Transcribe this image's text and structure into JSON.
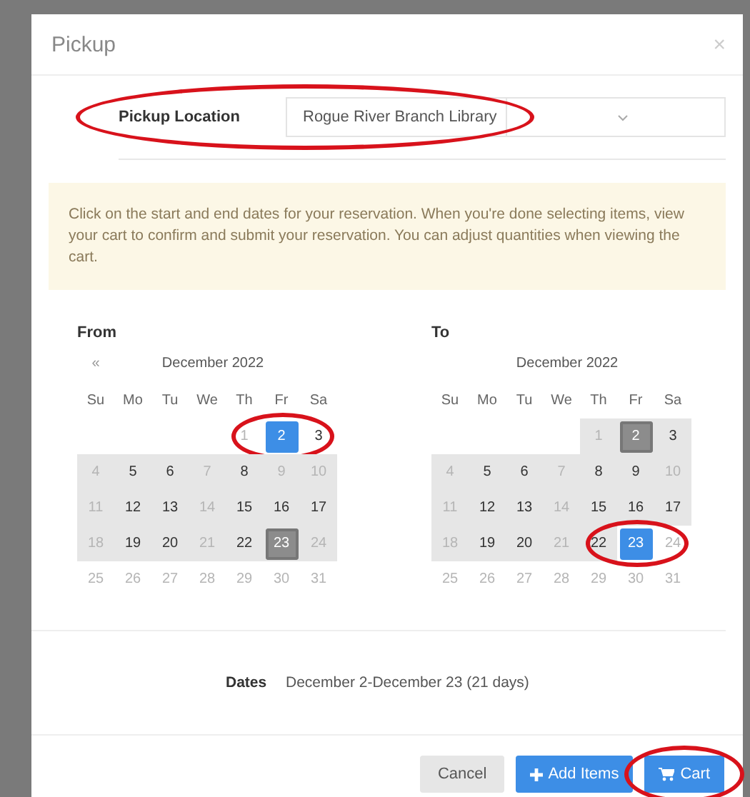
{
  "dialog": {
    "title": "Pickup",
    "close": "×"
  },
  "pickup": {
    "label": "Pickup Location",
    "value": "Rogue River Branch Library",
    "circled": true
  },
  "notice": "Click on the start and end dates for your reservation. When you're done selecting items, view your cart to confirm and submit your reservation. You can adjust quantities when viewing the cart.",
  "calendars": [
    {
      "label": "From",
      "prev": "«",
      "month": "December 2022",
      "weekdays": [
        "Su",
        "Mo",
        "Tu",
        "We",
        "Th",
        "Fr",
        "Sa"
      ],
      "weeks": [
        [
          {
            "day": "1",
            "muted": true,
            "in_range": false,
            "selected": false,
            "range_end": false,
            "circled": false
          },
          {
            "day": "2",
            "muted": false,
            "in_range": false,
            "selected": true,
            "range_end": false,
            "circled": true
          },
          {
            "day": "3",
            "muted": false,
            "in_range": false,
            "selected": false,
            "range_end": false,
            "circled": false
          }
        ],
        [
          {
            "day": "4",
            "muted": true,
            "in_range": true,
            "selected": false,
            "range_end": false,
            "circled": false
          },
          {
            "day": "5",
            "muted": false,
            "in_range": true,
            "selected": false,
            "range_end": false,
            "circled": false
          },
          {
            "day": "6",
            "muted": false,
            "in_range": true,
            "selected": false,
            "range_end": false,
            "circled": false
          },
          {
            "day": "7",
            "muted": true,
            "in_range": true,
            "selected": false,
            "range_end": false,
            "circled": false
          },
          {
            "day": "8",
            "muted": false,
            "in_range": true,
            "selected": false,
            "range_end": false,
            "circled": false
          },
          {
            "day": "9",
            "muted": true,
            "in_range": true,
            "selected": false,
            "range_end": false,
            "circled": false
          },
          {
            "day": "10",
            "muted": true,
            "in_range": true,
            "selected": false,
            "range_end": false,
            "circled": false
          }
        ],
        [
          {
            "day": "11",
            "muted": true,
            "in_range": true,
            "selected": false,
            "range_end": false,
            "circled": false
          },
          {
            "day": "12",
            "muted": false,
            "in_range": true,
            "selected": false,
            "range_end": false,
            "circled": false
          },
          {
            "day": "13",
            "muted": false,
            "in_range": true,
            "selected": false,
            "range_end": false,
            "circled": false
          },
          {
            "day": "14",
            "muted": true,
            "in_range": true,
            "selected": false,
            "range_end": false,
            "circled": false
          },
          {
            "day": "15",
            "muted": false,
            "in_range": true,
            "selected": false,
            "range_end": false,
            "circled": false
          },
          {
            "day": "16",
            "muted": false,
            "in_range": true,
            "selected": false,
            "range_end": false,
            "circled": false
          },
          {
            "day": "17",
            "muted": false,
            "in_range": true,
            "selected": false,
            "range_end": false,
            "circled": false
          }
        ],
        [
          {
            "day": "18",
            "muted": true,
            "in_range": true,
            "selected": false,
            "range_end": false,
            "circled": false
          },
          {
            "day": "19",
            "muted": false,
            "in_range": true,
            "selected": false,
            "range_end": false,
            "circled": false
          },
          {
            "day": "20",
            "muted": false,
            "in_range": true,
            "selected": false,
            "range_end": false,
            "circled": false
          },
          {
            "day": "21",
            "muted": true,
            "in_range": true,
            "selected": false,
            "range_end": false,
            "circled": false
          },
          {
            "day": "22",
            "muted": false,
            "in_range": true,
            "selected": false,
            "range_end": false,
            "circled": false
          },
          {
            "day": "23",
            "muted": false,
            "in_range": true,
            "selected": false,
            "range_end": true,
            "circled": false
          },
          {
            "day": "24",
            "muted": true,
            "in_range": true,
            "selected": false,
            "range_end": false,
            "circled": false
          }
        ],
        [
          {
            "day": "25",
            "muted": true,
            "in_range": false,
            "selected": false,
            "range_end": false,
            "circled": false
          },
          {
            "day": "26",
            "muted": true,
            "in_range": false,
            "selected": false,
            "range_end": false,
            "circled": false
          },
          {
            "day": "27",
            "muted": true,
            "in_range": false,
            "selected": false,
            "range_end": false,
            "circled": false
          },
          {
            "day": "28",
            "muted": true,
            "in_range": false,
            "selected": false,
            "range_end": false,
            "circled": false
          },
          {
            "day": "29",
            "muted": true,
            "in_range": false,
            "selected": false,
            "range_end": false,
            "circled": false
          },
          {
            "day": "30",
            "muted": true,
            "in_range": false,
            "selected": false,
            "range_end": false,
            "circled": false
          },
          {
            "day": "31",
            "muted": true,
            "in_range": false,
            "selected": false,
            "range_end": false,
            "circled": false
          }
        ]
      ]
    },
    {
      "label": "To",
      "month": "December 2022",
      "weekdays": [
        "Su",
        "Mo",
        "Tu",
        "We",
        "Th",
        "Fr",
        "Sa"
      ],
      "weeks": [
        [
          {
            "day": "1",
            "muted": true,
            "in_range": true,
            "selected": false,
            "range_end": false,
            "circled": false
          },
          {
            "day": "2",
            "muted": false,
            "in_range": true,
            "selected": false,
            "range_end": true,
            "circled": false
          },
          {
            "day": "3",
            "muted": false,
            "in_range": true,
            "selected": false,
            "range_end": false,
            "circled": false
          }
        ],
        [
          {
            "day": "4",
            "muted": true,
            "in_range": true,
            "selected": false,
            "range_end": false,
            "circled": false
          },
          {
            "day": "5",
            "muted": false,
            "in_range": true,
            "selected": false,
            "range_end": false,
            "circled": false
          },
          {
            "day": "6",
            "muted": false,
            "in_range": true,
            "selected": false,
            "range_end": false,
            "circled": false
          },
          {
            "day": "7",
            "muted": true,
            "in_range": true,
            "selected": false,
            "range_end": false,
            "circled": false
          },
          {
            "day": "8",
            "muted": false,
            "in_range": true,
            "selected": false,
            "range_end": false,
            "circled": false
          },
          {
            "day": "9",
            "muted": false,
            "in_range": true,
            "selected": false,
            "range_end": false,
            "circled": false
          },
          {
            "day": "10",
            "muted": true,
            "in_range": true,
            "selected": false,
            "range_end": false,
            "circled": false
          }
        ],
        [
          {
            "day": "11",
            "muted": true,
            "in_range": true,
            "selected": false,
            "range_end": false,
            "circled": false
          },
          {
            "day": "12",
            "muted": false,
            "in_range": true,
            "selected": false,
            "range_end": false,
            "circled": false
          },
          {
            "day": "13",
            "muted": false,
            "in_range": true,
            "selected": false,
            "range_end": false,
            "circled": false
          },
          {
            "day": "14",
            "muted": true,
            "in_range": true,
            "selected": false,
            "range_end": false,
            "circled": false
          },
          {
            "day": "15",
            "muted": false,
            "in_range": true,
            "selected": false,
            "range_end": false,
            "circled": false
          },
          {
            "day": "16",
            "muted": false,
            "in_range": true,
            "selected": false,
            "range_end": false,
            "circled": false
          },
          {
            "day": "17",
            "muted": false,
            "in_range": true,
            "selected": false,
            "range_end": false,
            "circled": false
          }
        ],
        [
          {
            "day": "18",
            "muted": true,
            "in_range": true,
            "selected": false,
            "range_end": false,
            "circled": false
          },
          {
            "day": "19",
            "muted": false,
            "in_range": true,
            "selected": false,
            "range_end": false,
            "circled": false
          },
          {
            "day": "20",
            "muted": false,
            "in_range": true,
            "selected": false,
            "range_end": false,
            "circled": false
          },
          {
            "day": "21",
            "muted": true,
            "in_range": true,
            "selected": false,
            "range_end": false,
            "circled": false
          },
          {
            "day": "22",
            "muted": false,
            "in_range": true,
            "selected": false,
            "range_end": false,
            "circled": false
          },
          {
            "day": "23",
            "muted": false,
            "in_range": false,
            "selected": true,
            "range_end": false,
            "circled": true
          },
          {
            "day": "24",
            "muted": true,
            "in_range": false,
            "selected": false,
            "range_end": false,
            "circled": false
          }
        ],
        [
          {
            "day": "25",
            "muted": true,
            "in_range": false,
            "selected": false,
            "range_end": false,
            "circled": false
          },
          {
            "day": "26",
            "muted": true,
            "in_range": false,
            "selected": false,
            "range_end": false,
            "circled": false
          },
          {
            "day": "27",
            "muted": true,
            "in_range": false,
            "selected": false,
            "range_end": false,
            "circled": false
          },
          {
            "day": "28",
            "muted": true,
            "in_range": false,
            "selected": false,
            "range_end": false,
            "circled": false
          },
          {
            "day": "29",
            "muted": true,
            "in_range": false,
            "selected": false,
            "range_end": false,
            "circled": false
          },
          {
            "day": "30",
            "muted": true,
            "in_range": false,
            "selected": false,
            "range_end": false,
            "circled": false
          },
          {
            "day": "31",
            "muted": true,
            "in_range": false,
            "selected": false,
            "range_end": false,
            "circled": false
          }
        ]
      ]
    }
  ],
  "dates": {
    "label": "Dates",
    "value": "December 2-December 23 (21 days)"
  },
  "buttons": [
    {
      "kind": "cancel",
      "label": "Cancel",
      "circled": false
    },
    {
      "kind": "add",
      "label": "Add Items",
      "circled": false
    },
    {
      "kind": "cart",
      "label": "Cart",
      "circled": true
    }
  ]
}
